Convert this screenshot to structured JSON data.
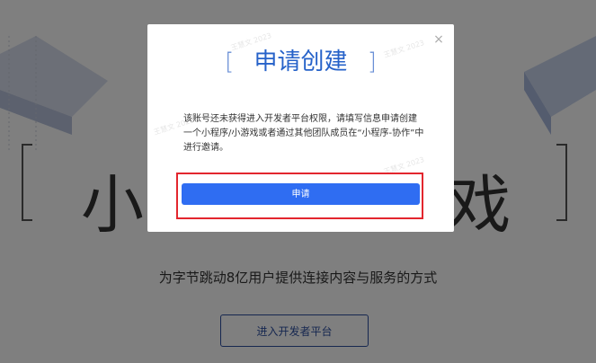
{
  "background": {
    "big_title": "小程序·小游戏",
    "slogan": "为字节跳动8亿用户提供连接内容与服务的方式",
    "enter_button": "进入开发者平台"
  },
  "modal": {
    "title": "申请创建",
    "bracket_left": "[",
    "bracket_right": "]",
    "close_icon": "×",
    "description": "该账号还未获得进入开发者平台权限，请填写信息申请创建一个小程序/小游戏或者通过其他团队成员在“小程序-协作”中进行邀请。",
    "apply_button": "申请",
    "watermark": "王慧文 2023"
  },
  "colors": {
    "accent": "#2f6df2",
    "title_blue": "#2662c9",
    "highlight": "#e3262e",
    "overlay": "rgba(0,0,0,0.5)"
  }
}
